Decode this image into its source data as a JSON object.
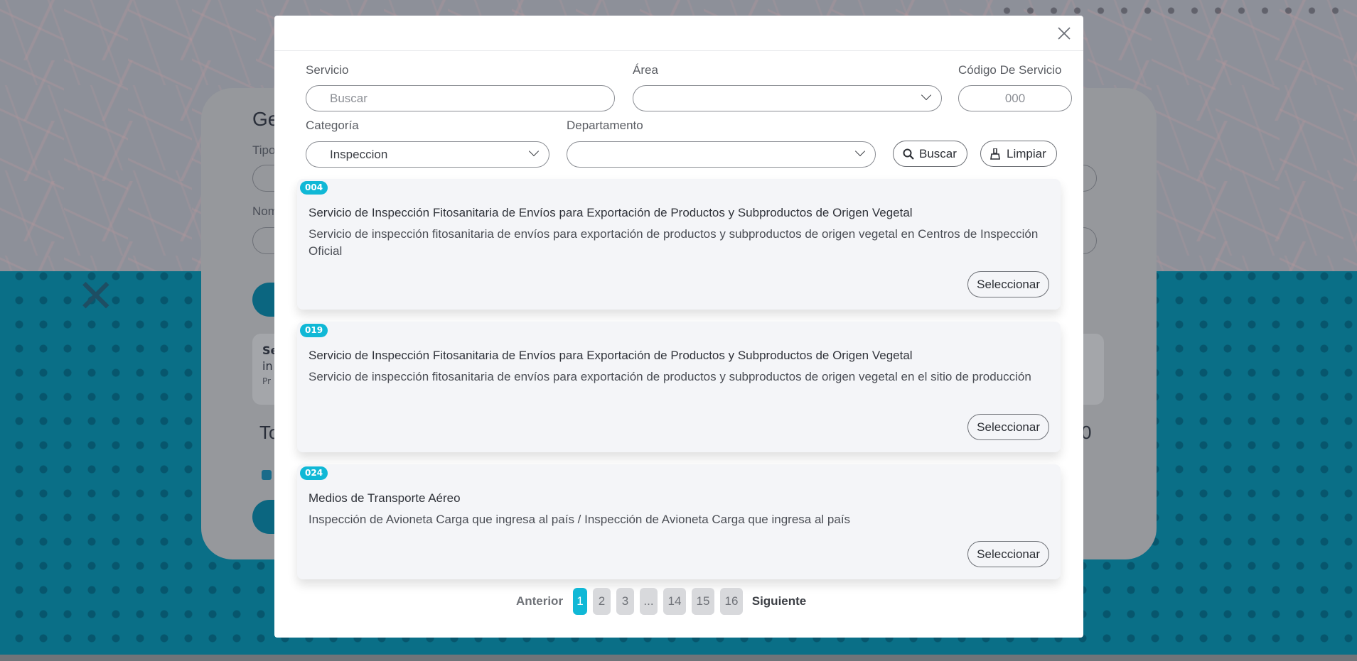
{
  "background": {
    "card_title_fragment": "Ge",
    "tipo_fragment": "Tipo",
    "nombre_fragment": "Nom",
    "total_fragment": "To",
    "amount_fragment": "0",
    "left_box_line1": "Se",
    "left_box_line2": "in",
    "left_box_line3": "Pr"
  },
  "modal": {
    "close_icon": "close-icon",
    "filters": {
      "servicio_label": "Servicio",
      "servicio_placeholder": "Buscar",
      "area_label": "Área",
      "area_value": "",
      "codigo_label": "Código De Servicio",
      "codigo_placeholder": "000",
      "categoria_label": "Categoría",
      "categoria_value": "Inspeccion",
      "departamento_label": "Departamento",
      "departamento_value": "",
      "buscar_label": "Buscar",
      "limpiar_label": "Limpiar"
    },
    "results": [
      {
        "code": "004",
        "title": "Servicio de Inspección Fitosanitaria de Envíos para Exportación de Productos y Subproductos de Origen Vegetal",
        "description": "Servicio de inspección fitosanitaria de envíos para exportación de productos y subproductos de origen vegetal en Centros de Inspección Oficial",
        "button": "Seleccionar"
      },
      {
        "code": "019",
        "title": "Servicio de Inspección Fitosanitaria de Envíos para Exportación de Productos y Subproductos de Origen Vegetal",
        "description": "Servicio de inspección fitosanitaria de envíos para exportación de productos y subproductos de origen vegetal en el sitio de producción",
        "button": "Seleccionar"
      },
      {
        "code": "024",
        "title": "Medios de Transporte Aéreo",
        "description": "Inspección de Avioneta Carga que ingresa al país / Inspección de Avioneta Carga que ingresa al país",
        "button": "Seleccionar"
      }
    ],
    "pagination": {
      "prev": "Anterior",
      "pages": [
        "1",
        "2",
        "3",
        "...",
        "14",
        "15",
        "16"
      ],
      "current": "1",
      "next": "Siguiente"
    }
  },
  "colors": {
    "accent": "#10b8d6",
    "overlay_teal": "#0a6f87"
  }
}
